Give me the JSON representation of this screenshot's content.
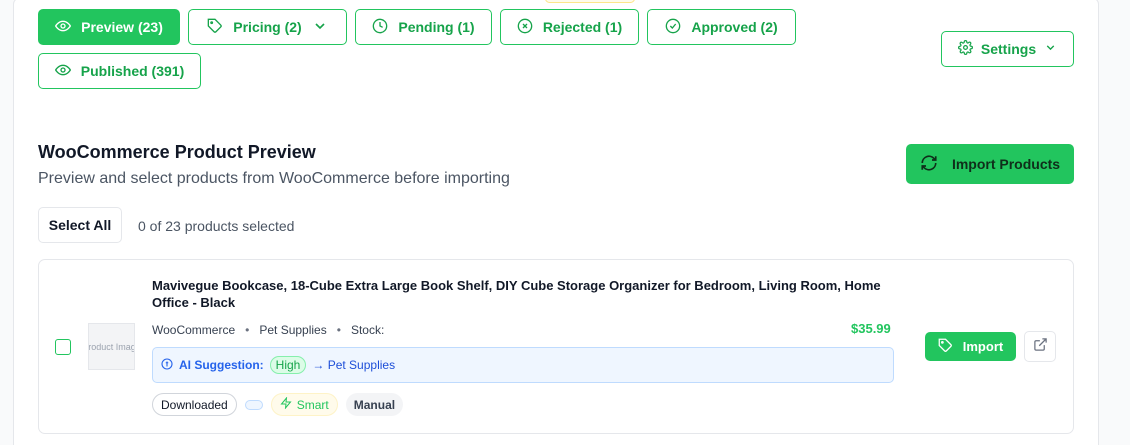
{
  "tabs": [
    {
      "label": "Preview (23)",
      "icon": "eye-icon",
      "active": true
    },
    {
      "label": "Pricing (2)",
      "icon": "tag-icon",
      "active": false,
      "dropdown": true
    },
    {
      "label": "Pending (1)",
      "icon": "clock-icon",
      "active": false
    },
    {
      "label": "Rejected (1)",
      "icon": "x-circle-icon",
      "active": false
    },
    {
      "label": "Approved (2)",
      "icon": "check-circle-icon",
      "active": false
    },
    {
      "label": "Published (391)",
      "icon": "eye-icon",
      "active": false
    }
  ],
  "settings": {
    "label": "Settings",
    "icon": "gear-icon"
  },
  "section": {
    "title": "WooCommerce Product Preview",
    "subtitle": "Preview and select products from WooCommerce before importing",
    "import_all_label": "Import Products"
  },
  "selection": {
    "select_all_label": "Select All",
    "count_text": "0 of 23 products selected"
  },
  "product": {
    "title": "Mavivegue Bookcase, 18-Cube Extra Large Book Shelf, DIY Cube Storage Organizer for Bedroom, Living Room, Home Office - Black",
    "thumb_alt": "Product Image",
    "source": "WooCommerce",
    "category": "Pet Supplies",
    "stock_label": "Stock:",
    "price": "$35.99",
    "ai": {
      "label": "AI Suggestion:",
      "confidence": "High",
      "suggested": "→ Pet Supplies"
    },
    "tags": {
      "downloaded": "Downloaded",
      "smart": "Smart",
      "manual": "Manual"
    },
    "import_label": "Import"
  },
  "colors": {
    "accent": "#22c55e",
    "accent_text": "#16a34a",
    "ai_bg": "#eff6ff",
    "ai_text": "#2563eb"
  }
}
